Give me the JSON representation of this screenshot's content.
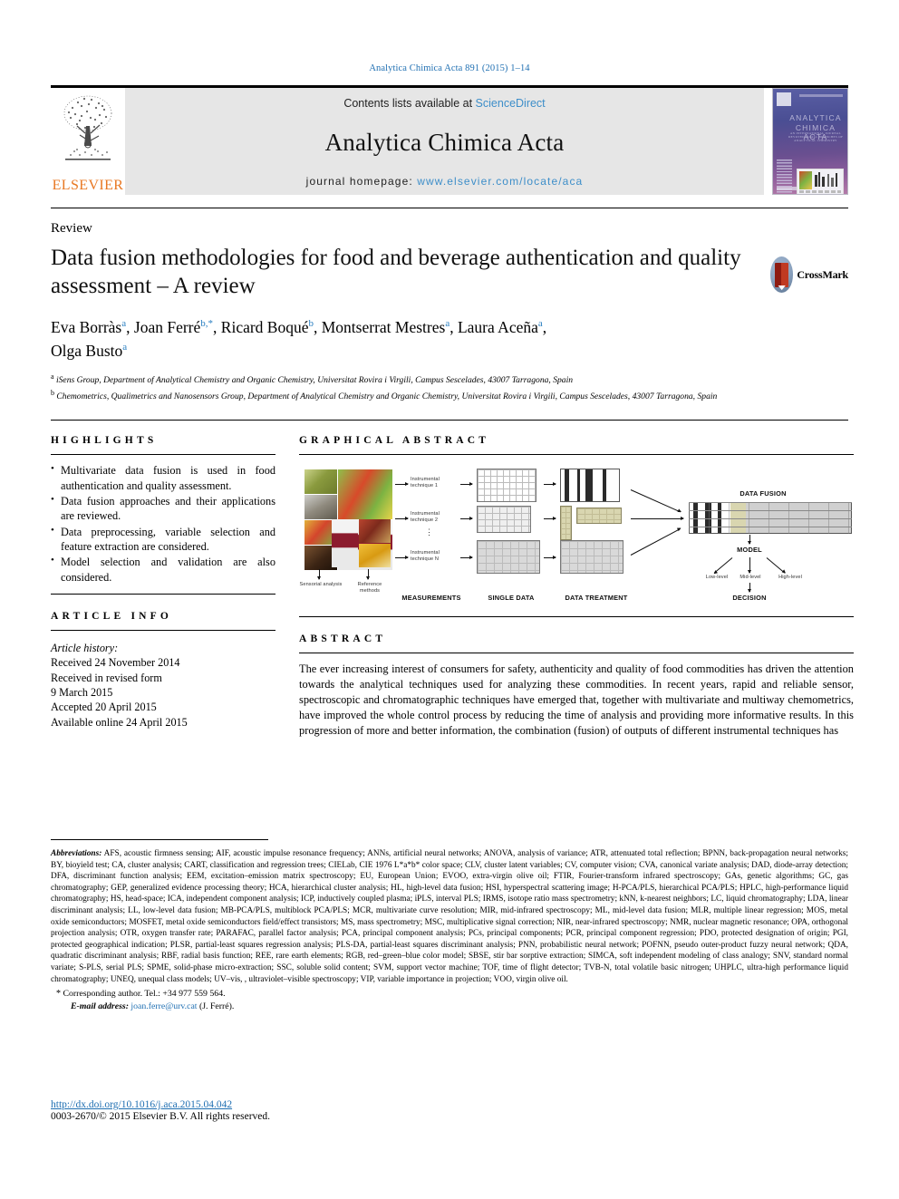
{
  "running_head": "Analytica Chimica Acta 891 (2015) 1–14",
  "journal_header": {
    "contents_prefix": "Contents lists available at",
    "sciencedirect": "ScienceDirect",
    "journal_title": "Analytica Chimica Acta",
    "homepage_label": "journal homepage:",
    "homepage_url": "www.elsevier.com/locate/aca",
    "publisher": "ELSEVIER",
    "cover_title": "ANALYTICA CHIMICA ACTA",
    "cover_subtitle": "AN INTERNATIONAL JOURNAL DEVOTED TO ALL BRANCHES OF ANALYTICAL CHEMISTRY"
  },
  "article": {
    "doctype": "Review",
    "title": "Data fusion methodologies for food and beverage authentication and quality assessment – A review",
    "crossmark_label": "CrossMark",
    "authors": "Eva Borràs a, Joan Ferré b,*, Ricard Boqué b, Montserrat Mestres a, Laura Aceña a, Olga Busto a",
    "author_list": [
      {
        "name": "Eva Borràs",
        "marks": "a"
      },
      {
        "name": "Joan Ferré",
        "marks": "b,*"
      },
      {
        "name": "Ricard Boqué",
        "marks": "b"
      },
      {
        "name": "Montserrat Mestres",
        "marks": "a"
      },
      {
        "name": "Laura Aceña",
        "marks": "a"
      },
      {
        "name": "Olga Busto",
        "marks": "a"
      }
    ],
    "affiliations": [
      {
        "mark": "a",
        "text": "iSens Group, Department of Analytical Chemistry and Organic Chemistry, Universitat Rovira i Virgili, Campus Sescelades, 43007 Tarragona, Spain"
      },
      {
        "mark": "b",
        "text": "Chemometrics, Qualimetrics and Nanosensors Group, Department of Analytical Chemistry and Organic Chemistry, Universitat Rovira i Virgili, Campus Sescelades, 43007 Tarragona, Spain"
      }
    ]
  },
  "highlights": {
    "heading": "HIGHLIGHTS",
    "items": [
      "Multivariate data fusion is used in food authentication and quality assessment.",
      "Data fusion approaches and their applications are reviewed.",
      "Data preprocessing, variable selection and feature extraction are considered.",
      "Model selection and validation are also considered."
    ]
  },
  "article_info": {
    "heading": "ARTICLE INFO",
    "history_label": "Article history:",
    "lines": [
      "Received 24 November 2014",
      "Received in revised form",
      "9 March 2015",
      "Accepted 20 April 2015",
      "Available online 24 April 2015"
    ]
  },
  "graphical_abstract": {
    "heading": "GRAPHICAL ABSTRACT",
    "source_labels": [
      "Sensorial analysis",
      "Reference methods"
    ],
    "technique_labels": [
      "Instrumental technique 1",
      "Instrumental technique 2",
      "Instrumental technique N"
    ],
    "column_captions": [
      "MEASUREMENTS",
      "SINGLE DATA",
      "DATA TREATMENT"
    ],
    "fusion_label": "DATA FUSION",
    "model_label": "MODEL",
    "model_levels": [
      "Low-level",
      "Mid-level",
      "High-level"
    ],
    "decision_label": "DECISION"
  },
  "abstract": {
    "heading": "ABSTRACT",
    "text": "The ever increasing interest of consumers for safety, authenticity and quality of food commodities has driven the attention towards the analytical techniques used for analyzing these commodities. In recent years, rapid and reliable sensor, spectroscopic and chromatographic techniques have emerged that, together with multivariate and multiway chemometrics, have improved the whole control process by reducing the time of analysis and providing more informative results. In this progression of more and better information, the combination (fusion) of outputs of different instrumental techniques has"
  },
  "abbreviations": {
    "label": "Abbreviations:",
    "text": "AFS, acoustic firmness sensing; AIF, acoustic impulse resonance frequency; ANNs, artificial neural networks; ANOVA, analysis of variance; ATR, attenuated total reflection; BPNN, back-propagation neural networks; BY, bioyield test; CA, cluster analysis; CART, classification and regression trees; CIELab, CIE 1976 L*a*b* color space; CLV, cluster latent variables; CV, computer vision; CVA, canonical variate analysis; DAD, diode-array detection; DFA, discriminant function analysis; EEM, excitation–emission matrix spectroscopy; EU, European Union; EVOO, extra-virgin olive oil; FTIR, Fourier-transform infrared spectroscopy; GAs, genetic algorithms; GC, gas chromatography; GEP, generalized evidence processing theory; HCA, hierarchical cluster analysis; HL, high-level data fusion; HSI, hyperspectral scattering image; H-PCA/PLS, hierarchical PCA/PLS; HPLC, high-performance liquid chromatography; HS, head-space; ICA, independent component analysis; ICP, inductively coupled plasma; iPLS, interval PLS; IRMS, isotope ratio mass spectrometry; kNN, k-nearest neighbors; LC, liquid chromatography; LDA, linear discriminant analysis; LL, low-level data fusion; MB-PCA/PLS, multiblock PCA/PLS; MCR, multivariate curve resolution; MIR, mid-infrared spectroscopy; ML, mid-level data fusion; MLR, multiple linear regression; MOS, metal oxide semiconductors; MOSFET, metal oxide semiconductors field/effect transistors; MS, mass spectrometry; MSC, multiplicative signal correction; NIR, near-infrared spectroscopy; NMR, nuclear magnetic resonance; OPA, orthogonal projection analysis; OTR, oxygen transfer rate; PARAFAC, parallel factor analysis; PCA, principal component analysis; PCs, principal components; PCR, principal component regression; PDO, protected designation of origin; PGI, protected geographical indication; PLSR, partial-least squares regression analysis; PLS-DA, partial-least squares discriminant analysis; PNN, probabilistic neural network; POFNN, pseudo outer-product fuzzy neural network; QDA, quadratic discriminant analysis; RBF, radial basis function; REE, rare earth elements; RGB, red–green–blue color model; SBSE, stir bar sorptive extraction; SIMCA, soft independent modeling of class analogy; SNV, standard normal variate; S-PLS, serial PLS; SPME, solid-phase micro-extraction; SSC, soluble solid content; SVM, support vector machine; TOF, time of flight detector; TVB-N, total volatile basic nitrogen; UHPLC, ultra-high performance liquid chromatography; UNEQ, unequal class models; UV–vis, , ultraviolet–visible spectroscopy; VIP, variable importance in projection; VOO, virgin olive oil."
  },
  "corresponding": {
    "star": "*",
    "text": "Corresponding author. Tel.: +34 977 559 564.",
    "email_label": "E-mail address:",
    "email": "joan.ferre@urv.cat",
    "email_suffix": "(J. Ferré)."
  },
  "footer": {
    "doi": "http://dx.doi.org/10.1016/j.aca.2015.04.042",
    "copyright": "0003-2670/© 2015 Elsevier B.V. All rights reserved."
  },
  "colors": {
    "link_blue": "#1f6fb2",
    "sciencedirect_blue": "#3d8ec9",
    "elsevier_orange": "#e87722",
    "header_band": "#e6e6e6"
  }
}
